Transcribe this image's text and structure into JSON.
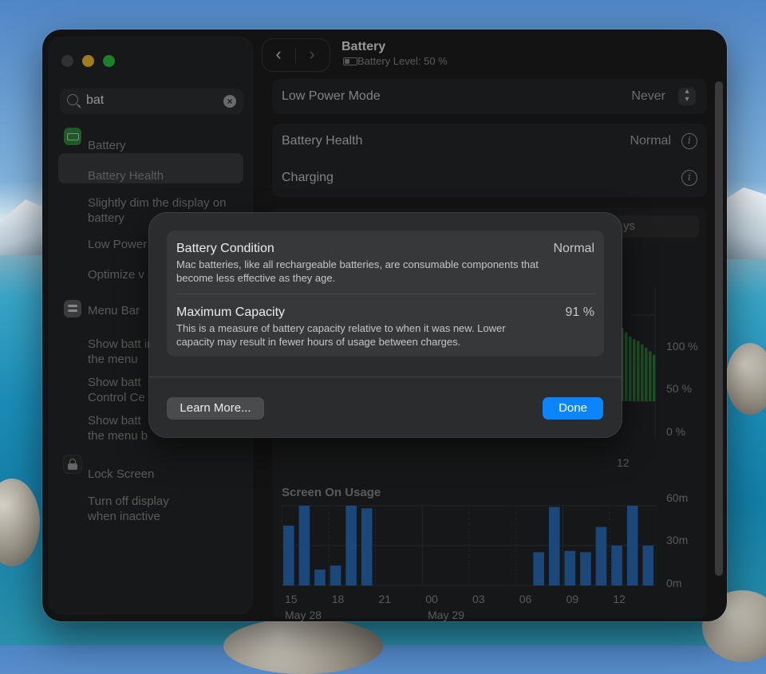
{
  "sidebar": {
    "search_value": "bat",
    "items": [
      {
        "label": "Battery",
        "icon": "battery-icon",
        "icon_color": "#2e8b3d"
      },
      {
        "label": "Battery Health"
      },
      {
        "label": "Slightly dim the display on battery"
      },
      {
        "label": "Low Power"
      },
      {
        "label": "Optimize v"
      },
      {
        "label": "Menu Bar",
        "icon": "menu-bar-icon",
        "icon_color": "#5a5c5e"
      },
      {
        "label": "Show batt in the menu"
      },
      {
        "label": "Show batt Control Ce"
      },
      {
        "label": "Show batt the menu b"
      },
      {
        "label": "Lock Screen",
        "icon": "lock-icon",
        "icon_color": "#2a2b2c"
      },
      {
        "label": "Turn off display when inactive"
      }
    ]
  },
  "header": {
    "title": "Battery",
    "subtitle": "Battery Level: 50 %"
  },
  "settings": {
    "low_power_label": "Low Power Mode",
    "low_power_value": "Never",
    "health_label": "Battery Health",
    "health_value": "Normal",
    "charging_label": "Charging",
    "tab_partial": "ys"
  },
  "battery_chart": {
    "y_labels": [
      "100 %",
      "50 %",
      "0 %"
    ],
    "x_label_partial": "12",
    "bar_color": "#2f7a3a",
    "values": [
      85,
      80,
      75,
      72,
      70,
      66,
      62,
      58,
      54
    ]
  },
  "chart_data": {
    "type": "bar",
    "title": "Screen On Usage",
    "x_ticks": [
      "15",
      "18",
      "21",
      "00",
      "03",
      "06",
      "09",
      "12"
    ],
    "date_labels": [
      "May 28",
      "May 29"
    ],
    "y_ticks": [
      "60m",
      "30m",
      "0m"
    ],
    "ylim": [
      0,
      60
    ],
    "bar_color": "#2a6fbd",
    "values": [
      45,
      60,
      12,
      15,
      60,
      58,
      0,
      0,
      0,
      0,
      0,
      0,
      0,
      0,
      0,
      0,
      25,
      59,
      26,
      25,
      44,
      30,
      60,
      30
    ]
  },
  "modal": {
    "condition_title": "Battery Condition",
    "condition_value": "Normal",
    "condition_desc": "Mac batteries, like all rechargeable batteries, are consumable components that become less effective as they age.",
    "capacity_title": "Maximum Capacity",
    "capacity_value": "91 %",
    "capacity_desc": "This is a measure of battery capacity relative to when it was new. Lower capacity may result in fewer hours of usage between charges.",
    "learn_more_label": "Learn More...",
    "done_label": "Done"
  }
}
